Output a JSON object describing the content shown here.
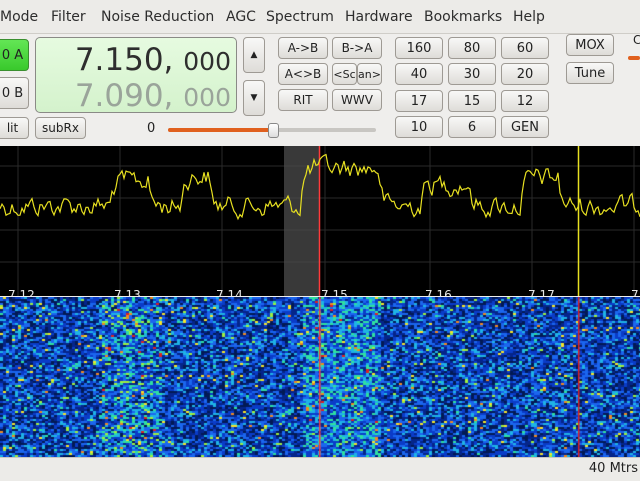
{
  "menu": {
    "items": [
      "Mode",
      "Filter",
      "Noise Reduction",
      "AGC",
      "Spectrum",
      "Hardware",
      "Bookmarks",
      "Help"
    ]
  },
  "vfo": {
    "a_label": "0 A",
    "b_label": "0 B",
    "split_label": "lit",
    "subrx_label": "subRx",
    "freq_main": "7.150,",
    "freq_main_small": "000",
    "freq_sub": "7.090,",
    "freq_sub_small": "000"
  },
  "vfo_buttons": {
    "a_to_b": "A->B",
    "b_to_a": "B->A",
    "swap": "A<>B",
    "scan1": "<Sc",
    "scan2": "an>",
    "rit": "RIT",
    "wwv": "WWV"
  },
  "slider": {
    "value_label": "0",
    "level": 0.5
  },
  "bands": [
    "160",
    "80",
    "60",
    "40",
    "30",
    "20",
    "17",
    "15",
    "12",
    "10",
    "6",
    "GEN"
  ],
  "controls": {
    "mox": "MOX",
    "tune": "Tune",
    "right_label": "C"
  },
  "panadapter": {
    "freq_labels": [
      "7.12",
      "7.13",
      "7.14",
      "7.15",
      "7.16",
      "7.17",
      "7"
    ]
  },
  "status": {
    "band": "40 Mtrs"
  },
  "colors": {
    "trace": "#e7e021",
    "cursor": "#ff3a3a",
    "vfo_active": "#3fd432",
    "accent": "#e0601e"
  }
}
